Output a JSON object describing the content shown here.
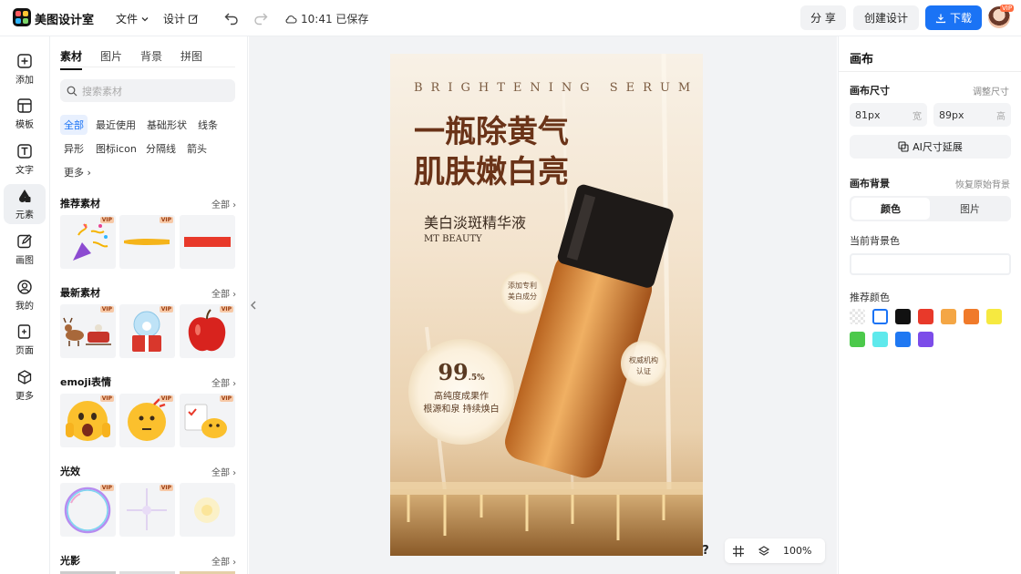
{
  "app": {
    "name": "美图设计室"
  },
  "topbar": {
    "file_label": "文件",
    "design_label": "设计",
    "save_status": "10:41 已保存",
    "share_label": "分 享",
    "create_label": "创建设计",
    "download_label": "下载",
    "vip_badge": "VIP"
  },
  "rail": {
    "items": [
      {
        "label": "添加",
        "icon": "plus-square-icon"
      },
      {
        "label": "模板",
        "icon": "template-icon"
      },
      {
        "label": "文字",
        "icon": "text-icon"
      },
      {
        "label": "元素",
        "icon": "shapes-icon"
      },
      {
        "label": "画图",
        "icon": "pen-icon"
      },
      {
        "label": "我的",
        "icon": "user-icon"
      },
      {
        "label": "页面",
        "icon": "page-icon"
      },
      {
        "label": "更多",
        "icon": "cube-icon"
      }
    ]
  },
  "panel": {
    "tabs": [
      "素材",
      "图片",
      "背景",
      "拼图"
    ],
    "search_placeholder": "搜索素材",
    "chips": [
      "全部",
      "最近使用",
      "基础形状",
      "线条",
      "异形",
      "图标icon",
      "分隔线",
      "箭头",
      "更多"
    ],
    "all_label": "全部",
    "sections": [
      {
        "title": "推荐素材"
      },
      {
        "title": "最新素材"
      },
      {
        "title": "emoji表情"
      },
      {
        "title": "光效"
      },
      {
        "title": "光影"
      }
    ],
    "vip_label": "VIP"
  },
  "poster": {
    "eyebrow": "BRIGHTENING SERUM",
    "headline_1": "一瓶除黄气",
    "headline_2": "肌肤嫩白亮",
    "subtitle": "美白淡斑精华液",
    "brand": "MT BEAUTY",
    "badge_1_line1": "添加专利",
    "badge_1_line2": "美白成分",
    "badge_2_line1": "权威机构",
    "badge_2_line2": "认证",
    "stat_value": "99",
    "stat_unit": ".5%",
    "stat_line1": "高纯度成果作",
    "stat_line2": "根源和泉 持续焕白"
  },
  "bottom_tools": {
    "help": "?",
    "zoom": "100%"
  },
  "right_panel": {
    "title": "画布",
    "size_label": "画布尺寸",
    "adjust_label": "调整尺寸",
    "width_value": "81px",
    "width_unit": "宽",
    "height_value": "89px",
    "height_unit": "高",
    "ai_extend_label": "AI尺寸延展",
    "bg_label": "画布背景",
    "restore_label": "恢复原始背景",
    "seg_color": "颜色",
    "seg_image": "图片",
    "current_bg_label": "当前背景色",
    "recommend_label": "推荐颜色",
    "swatches": [
      "transparent",
      "#ffffff",
      "#111111",
      "#e8392a",
      "#f4a645",
      "#f07a2a",
      "#f6e940",
      "#4cc94b",
      "#5ee9ec",
      "#1f78f2",
      "#7c4ce9"
    ]
  }
}
